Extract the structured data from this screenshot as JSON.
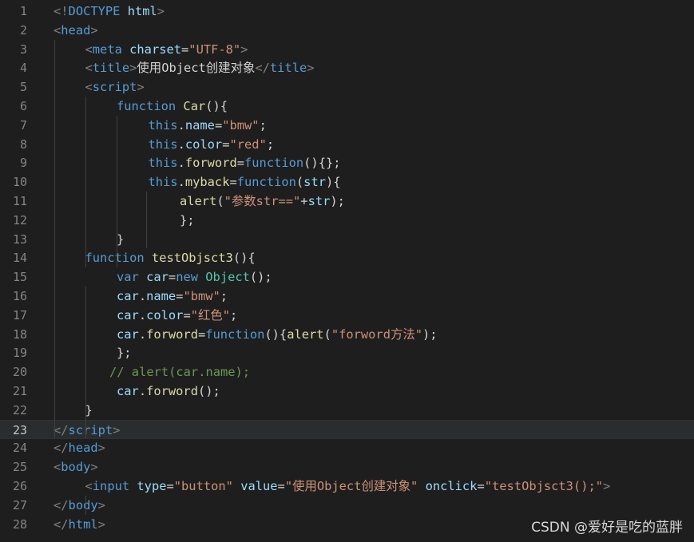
{
  "editor": {
    "active_line": 23,
    "lines": [
      {
        "n": "1",
        "indent": 0,
        "tokens": [
          [
            "punc",
            "<!"
          ],
          [
            "tag",
            "DOCTYPE"
          ],
          [
            "text",
            " "
          ],
          [
            "attr",
            "html"
          ],
          [
            "punc",
            ">"
          ]
        ]
      },
      {
        "n": "2",
        "indent": 0,
        "tokens": [
          [
            "punc",
            "<"
          ],
          [
            "tag",
            "head"
          ],
          [
            "punc",
            ">"
          ]
        ]
      },
      {
        "n": "3",
        "indent": 1,
        "tokens": [
          [
            "punc",
            "<"
          ],
          [
            "tag",
            "meta"
          ],
          [
            "text",
            " "
          ],
          [
            "attr",
            "charset"
          ],
          [
            "text",
            "="
          ],
          [
            "str",
            "\"UTF-8\""
          ],
          [
            "punc",
            ">"
          ]
        ]
      },
      {
        "n": "4",
        "indent": 1,
        "tokens": [
          [
            "punc",
            "<"
          ],
          [
            "tag",
            "title"
          ],
          [
            "punc",
            ">"
          ],
          [
            "text",
            "使用Object创建对象"
          ],
          [
            "punc",
            "</"
          ],
          [
            "tag",
            "title"
          ],
          [
            "punc",
            ">"
          ]
        ]
      },
      {
        "n": "5",
        "indent": 1,
        "tokens": [
          [
            "punc",
            "<"
          ],
          [
            "tag",
            "script"
          ],
          [
            "punc",
            ">"
          ]
        ]
      },
      {
        "n": "6",
        "indent": 2,
        "tokens": [
          [
            "kw",
            "function"
          ],
          [
            "text",
            " "
          ],
          [
            "fn",
            "Car"
          ],
          [
            "text",
            "(){"
          ]
        ]
      },
      {
        "n": "7",
        "indent": 3,
        "tokens": [
          [
            "kw",
            "this"
          ],
          [
            "text",
            "."
          ],
          [
            "prop",
            "name"
          ],
          [
            "text",
            "="
          ],
          [
            "str",
            "\"bmw\""
          ],
          [
            "text",
            ";"
          ]
        ]
      },
      {
        "n": "8",
        "indent": 3,
        "tokens": [
          [
            "kw",
            "this"
          ],
          [
            "text",
            "."
          ],
          [
            "prop",
            "color"
          ],
          [
            "text",
            "="
          ],
          [
            "str",
            "\"red\""
          ],
          [
            "text",
            ";"
          ]
        ]
      },
      {
        "n": "9",
        "indent": 3,
        "tokens": [
          [
            "kw",
            "this"
          ],
          [
            "text",
            "."
          ],
          [
            "fn",
            "forword"
          ],
          [
            "text",
            "="
          ],
          [
            "kw",
            "function"
          ],
          [
            "text",
            "(){};"
          ]
        ]
      },
      {
        "n": "10",
        "indent": 3,
        "tokens": [
          [
            "kw",
            "this"
          ],
          [
            "text",
            "."
          ],
          [
            "fn",
            "myback"
          ],
          [
            "text",
            "="
          ],
          [
            "kw",
            "function"
          ],
          [
            "text",
            "("
          ],
          [
            "var",
            "str"
          ],
          [
            "text",
            "){"
          ]
        ]
      },
      {
        "n": "11",
        "indent": 4,
        "tokens": [
          [
            "fn",
            "alert"
          ],
          [
            "text",
            "("
          ],
          [
            "str",
            "\"参数str==\""
          ],
          [
            "text",
            "+"
          ],
          [
            "var",
            "str"
          ],
          [
            "text",
            ");"
          ]
        ]
      },
      {
        "n": "12",
        "indent": 4,
        "tokens": [
          [
            "text",
            "};"
          ]
        ]
      },
      {
        "n": "13",
        "indent": 2,
        "tokens": [
          [
            "text",
            "}"
          ]
        ]
      },
      {
        "n": "14",
        "indent": 1,
        "tokens": [
          [
            "kw",
            "function"
          ],
          [
            "text",
            " "
          ],
          [
            "fn",
            "testObjsct3"
          ],
          [
            "text",
            "(){"
          ]
        ]
      },
      {
        "n": "15",
        "indent": 2,
        "tokens": [
          [
            "kw",
            "var"
          ],
          [
            "text",
            " "
          ],
          [
            "var",
            "car"
          ],
          [
            "text",
            "="
          ],
          [
            "kw",
            "new"
          ],
          [
            "text",
            " "
          ],
          [
            "class",
            "Object"
          ],
          [
            "text",
            "();"
          ]
        ]
      },
      {
        "n": "16",
        "indent": 2,
        "tokens": [
          [
            "var",
            "car"
          ],
          [
            "text",
            "."
          ],
          [
            "prop",
            "name"
          ],
          [
            "text",
            "="
          ],
          [
            "str",
            "\"bmw\""
          ],
          [
            "text",
            ";"
          ]
        ]
      },
      {
        "n": "17",
        "indent": 2,
        "tokens": [
          [
            "var",
            "car"
          ],
          [
            "text",
            "."
          ],
          [
            "prop",
            "color"
          ],
          [
            "text",
            "="
          ],
          [
            "str",
            "\"红色\""
          ],
          [
            "text",
            ";"
          ]
        ]
      },
      {
        "n": "18",
        "indent": 2,
        "tokens": [
          [
            "var",
            "car"
          ],
          [
            "text",
            "."
          ],
          [
            "fn",
            "forword"
          ],
          [
            "text",
            "="
          ],
          [
            "kw",
            "function"
          ],
          [
            "text",
            "(){"
          ],
          [
            "fn",
            "alert"
          ],
          [
            "text",
            "("
          ],
          [
            "str",
            "\"forword方法\""
          ],
          [
            "text",
            ");"
          ]
        ]
      },
      {
        "n": "19",
        "indent": 2,
        "tokens": [
          [
            "text",
            "};"
          ]
        ]
      },
      {
        "n": "20",
        "indent": 2,
        "shift": -9,
        "tokens": [
          [
            "cmt",
            "// alert(car.name);"
          ]
        ]
      },
      {
        "n": "21",
        "indent": 2,
        "tokens": [
          [
            "var",
            "car"
          ],
          [
            "text",
            "."
          ],
          [
            "fn",
            "forword"
          ],
          [
            "text",
            "();"
          ]
        ]
      },
      {
        "n": "22",
        "indent": 1,
        "tokens": [
          [
            "text",
            "}"
          ]
        ]
      },
      {
        "n": "23",
        "indent": 0,
        "tokens": [
          [
            "punc",
            "</"
          ],
          [
            "tag",
            "script"
          ],
          [
            "punc",
            ">"
          ]
        ]
      },
      {
        "n": "24",
        "indent": 0,
        "tokens": [
          [
            "punc",
            "</"
          ],
          [
            "tag",
            "head"
          ],
          [
            "punc",
            ">"
          ]
        ]
      },
      {
        "n": "25",
        "indent": 0,
        "tokens": [
          [
            "punc",
            "<"
          ],
          [
            "tag",
            "body"
          ],
          [
            "punc",
            ">"
          ]
        ]
      },
      {
        "n": "26",
        "indent": 1,
        "tokens": [
          [
            "punc",
            "<"
          ],
          [
            "tag",
            "input"
          ],
          [
            "text",
            " "
          ],
          [
            "attr",
            "type"
          ],
          [
            "text",
            "="
          ],
          [
            "str",
            "\"button\""
          ],
          [
            "text",
            " "
          ],
          [
            "attr",
            "value"
          ],
          [
            "text",
            "="
          ],
          [
            "str",
            "\"使用Object创建对象\""
          ],
          [
            "text",
            " "
          ],
          [
            "attr",
            "onclick"
          ],
          [
            "text",
            "="
          ],
          [
            "str",
            "\"testObjsct3();\""
          ],
          [
            "punc",
            ">"
          ]
        ]
      },
      {
        "n": "27",
        "indent": 0,
        "tokens": [
          [
            "punc",
            "</"
          ],
          [
            "tag",
            "body"
          ],
          [
            "punc",
            ">"
          ]
        ]
      },
      {
        "n": "28",
        "indent": 0,
        "tokens": [
          [
            "punc",
            "</"
          ],
          [
            "tag",
            "html"
          ],
          [
            "punc",
            ">"
          ]
        ]
      }
    ]
  },
  "watermark": "CSDN @爱好是吃的蓝胖"
}
